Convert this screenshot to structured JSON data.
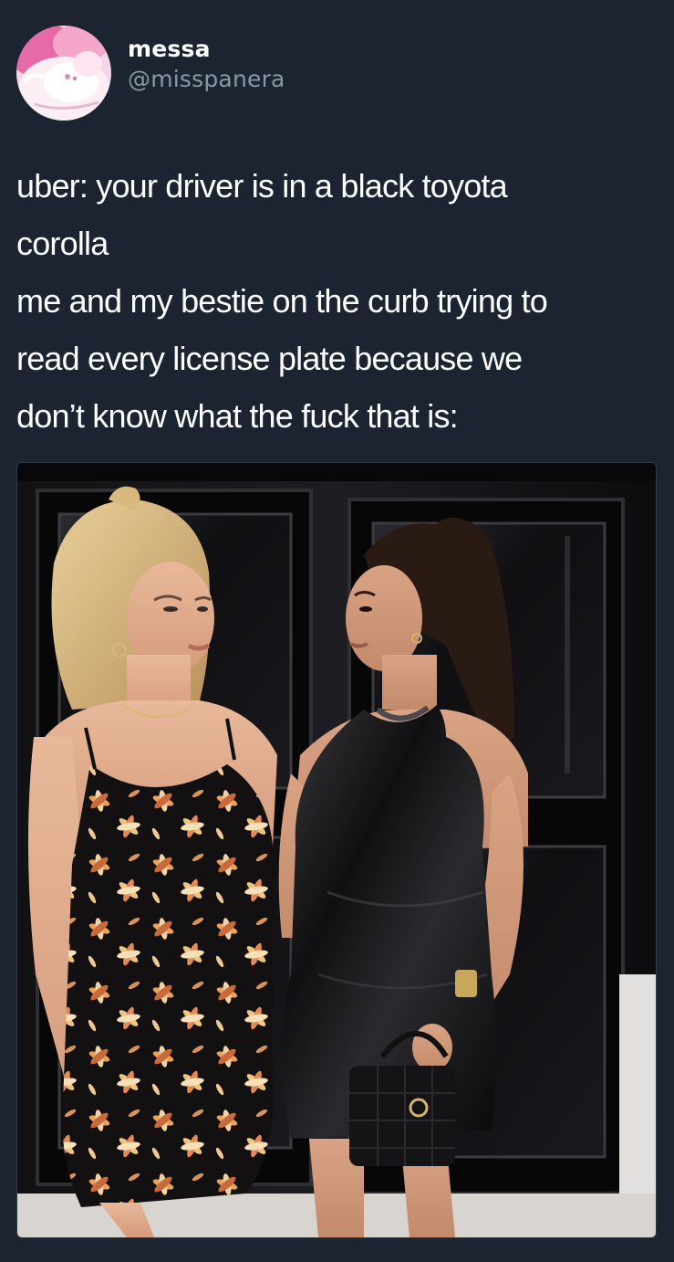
{
  "author": {
    "display_name": "messa",
    "handle": "@misspanera",
    "avatar_icon": "avatar-icon"
  },
  "tweet": {
    "lines": [
      "uber: your driver is in a black toyota",
      "corolla",
      "me and my bestie on the curb trying to",
      "read every license plate because we",
      "don’t know what the fuck that is:"
    ]
  },
  "media": {
    "description_icon": "photo-icon"
  },
  "colors": {
    "background": "#1b2430",
    "text": "#ffffff",
    "secondary_text": "#8899a6"
  }
}
